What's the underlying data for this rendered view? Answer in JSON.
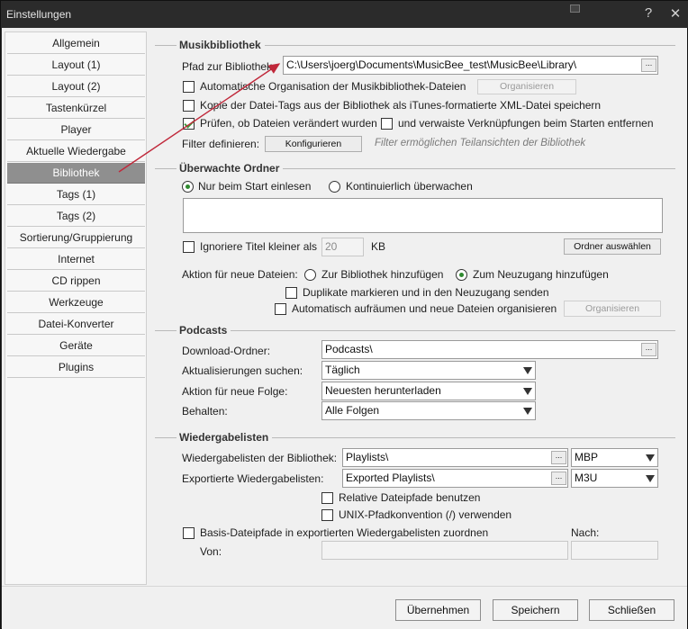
{
  "window": {
    "title": "Einstellungen",
    "help_label": "?",
    "close_label": "✕"
  },
  "sidebar": {
    "items": [
      {
        "label": "Allgemein"
      },
      {
        "label": "Layout (1)"
      },
      {
        "label": "Layout (2)"
      },
      {
        "label": "Tastenkürzel"
      },
      {
        "label": "Player"
      },
      {
        "label": "Aktuelle Wiedergabe"
      },
      {
        "label": "Bibliothek",
        "active": true
      },
      {
        "label": "Tags (1)"
      },
      {
        "label": "Tags (2)"
      },
      {
        "label": "Sortierung/Gruppierung"
      },
      {
        "label": "Internet"
      },
      {
        "label": "CD rippen"
      },
      {
        "label": "Werkzeuge"
      },
      {
        "label": "Datei-Konverter"
      },
      {
        "label": "Geräte"
      },
      {
        "label": "Plugins"
      }
    ]
  },
  "musikbibliothek": {
    "heading": "Musikbibliothek",
    "path_label": "Pfad zur Bibliothek",
    "path_value": "C:\\Users\\joerg\\Documents\\MusicBee_test\\MusicBee\\Library\\",
    "browse": "...",
    "auto_org_label": "Automatische Organisation der Musikbibliothek-Dateien",
    "auto_org_checked": false,
    "organisieren_btn": "Organisieren",
    "xml_label": "Kopie der Datei-Tags aus der Bibliothek als iTunes-formatierte XML-Datei speichern",
    "xml_checked": false,
    "check_changed_label": "Prüfen, ob Dateien verändert wurden",
    "check_changed_checked": true,
    "orphan_label": "und verwaiste Verknüpfungen beim Starten entfernen",
    "orphan_checked": false,
    "filter_label": "Filter definieren:",
    "configure_btn": "Konfigurieren",
    "filter_hint": "Filter ermöglichen Teilansichten der Bibliothek"
  },
  "ueberwachte": {
    "heading": "Überwachte Ordner",
    "radio_start": "Nur beim Start einlesen",
    "radio_cont": "Kontinuierlich überwachen",
    "selected": "start",
    "ignore_label": "Ignoriere Titel kleiner als",
    "ignore_checked": false,
    "ignore_value": "20",
    "kb_label": "KB",
    "choose_folder_btn": "Ordner auswählen",
    "action_label": "Aktion für neue Dateien:",
    "action_lib": "Zur Bibliothek hinzufügen",
    "action_inbox": "Zum Neuzugang hinzufügen",
    "action_selected": "inbox",
    "dup_label": "Duplikate markieren und in den Neuzugang senden",
    "dup_checked": false,
    "auto_clean_label": "Automatisch aufräumen und neue Dateien organisieren",
    "auto_clean_checked": false,
    "organisieren_btn": "Organisieren"
  },
  "podcasts": {
    "heading": "Podcasts",
    "download_label": "Download-Ordner:",
    "download_value": "Podcasts\\",
    "browse": "...",
    "update_label": "Aktualisierungen suchen:",
    "update_value": "Täglich",
    "action_label": "Aktion für neue Folge:",
    "action_value": "Neuesten herunterladen",
    "keep_label": "Behalten:",
    "keep_value": "Alle Folgen"
  },
  "playlists": {
    "heading": "Wiedergabelisten",
    "library_label": "Wiedergabelisten der Bibliothek:",
    "library_value": "Playlists\\",
    "library_format": "MBP",
    "export_label": "Exportierte Wiedergabelisten:",
    "export_value": "Exported Playlists\\",
    "export_format": "M3U",
    "browse": "...",
    "relative_label": "Relative Dateipfade benutzen",
    "relative_checked": false,
    "unix_label": "UNIX-Pfadkonvention (/) verwenden",
    "unix_checked": false,
    "base_label": "Basis-Dateipfade in exportierten Wiedergabelisten zuordnen",
    "base_checked": false,
    "from_label": "Von:",
    "to_label": "Nach:"
  },
  "footer": {
    "apply": "Übernehmen",
    "save": "Speichern",
    "close": "Schließen"
  },
  "colors": {
    "annotation_arrow": "#c0283a",
    "active_nav": "#8f8f8f"
  }
}
